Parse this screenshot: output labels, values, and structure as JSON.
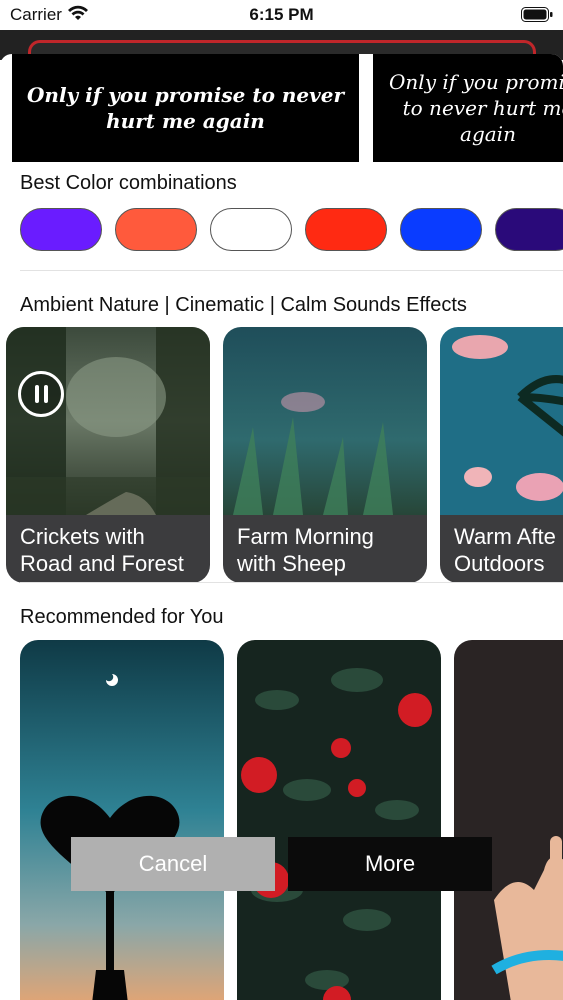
{
  "status_bar": {
    "carrier": "Carrier",
    "time": "6:15 PM"
  },
  "quotes": [
    {
      "text": "Only if you promise to never hurt me again"
    },
    {
      "text": "Only if you promise to never hurt me again"
    }
  ],
  "colors_section": {
    "title": "Best Color combinations",
    "swatches": [
      "#6a1cff",
      "#ff5a3c",
      "#ffffff",
      "#ff2a12",
      "#0a3cff",
      "#2a0a7a"
    ]
  },
  "ambient_section": {
    "title": "Ambient Nature | Cinematic | Calm Sounds Effects",
    "cards": [
      {
        "label": "Crickets with\nRoad and Forest",
        "playing": true
      },
      {
        "label": "Farm Morning\nwith Sheep",
        "playing": false
      },
      {
        "label": "Warm Afte\nOutdoors",
        "playing": false
      }
    ]
  },
  "recommended_section": {
    "title": "Recommended for You"
  },
  "actions": {
    "cancel_label": "Cancel",
    "more_label": "More"
  }
}
